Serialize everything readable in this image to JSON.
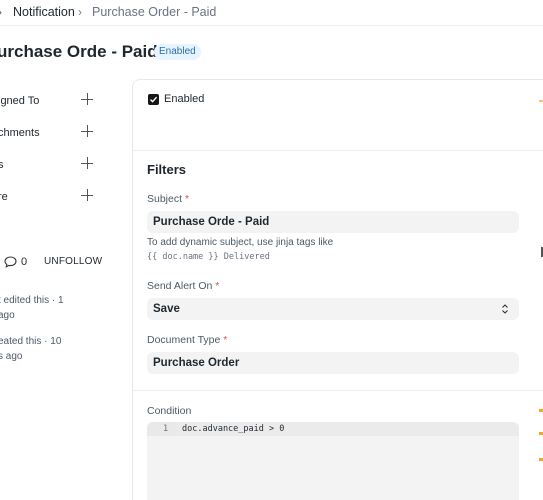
{
  "breadcrumb": {
    "sep": "›",
    "items": [
      "Notification",
      "Purchase Order - Paid"
    ]
  },
  "header": {
    "title": "urchase Orde - Paid",
    "status": "Enabled"
  },
  "sidebar": {
    "items": [
      {
        "label": "igned To",
        "icon": "plus-icon"
      },
      {
        "label": "chments",
        "icon": "plus-icon"
      },
      {
        "label": "s",
        "icon": "plus-icon"
      },
      {
        "label": "re",
        "icon": "plus-icon"
      }
    ],
    "comments": "0",
    "unfollow": "UNFOLLOW",
    "activity": [
      {
        "line1": "t edited this · 1",
        "line2": "ago"
      },
      {
        "line1": "eated this · 10",
        "line2": "s ago"
      }
    ]
  },
  "form": {
    "enabled_label": "Enabled",
    "enabled_checked": true,
    "filters_title": "Filters",
    "subject": {
      "label": "Subject",
      "required": "*",
      "value": "Purchase Orde - Paid",
      "help": "To add dynamic subject, use jinja tags like",
      "help_code": "{{ doc.name }} Delivered"
    },
    "send_alert_on": {
      "label": "Send Alert On",
      "required": "*",
      "value": "Save"
    },
    "document_type": {
      "label": "Document Type",
      "required": "*",
      "value": "Purchase Order"
    },
    "condition": {
      "label": "Condition",
      "line_number": "1",
      "code": "doc.advance_paid > 0"
    }
  },
  "colors": {
    "badge_bg": "#e6f4ff",
    "badge_text": "#2f6fa8",
    "required": "#e24c4c",
    "input_bg": "#f3f3f3"
  }
}
